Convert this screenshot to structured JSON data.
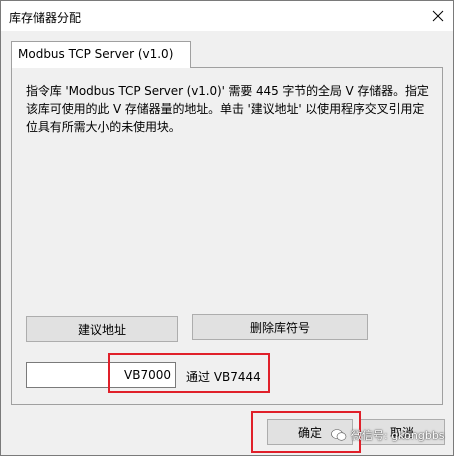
{
  "window": {
    "title": "库存储器分配"
  },
  "tabs": [
    {
      "label": "Modbus TCP Server (v1.0)"
    }
  ],
  "panel": {
    "description": "指令库 'Modbus TCP Server (v1.0)' 需要 445 字节的全局 V 存储器。指定该库可使用的此 V 存储器量的地址。单击 '建议地址' 以使用程序交叉引用定位具有所需大小的未使用块。",
    "suggest_button": "建议地址",
    "delete_button": "删除库符号",
    "address_value": "VB7000",
    "through_text": "通过 VB7444"
  },
  "footer": {
    "ok_button": "确定",
    "cancel_button": "取消"
  },
  "watermark": {
    "text": "微信号: gkongbbs"
  }
}
